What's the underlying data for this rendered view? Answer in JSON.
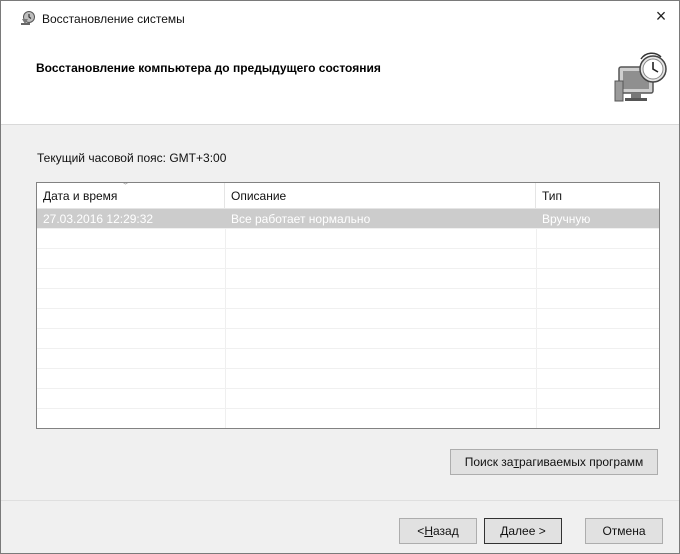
{
  "window": {
    "title": "Восстановление системы",
    "close_glyph": "×"
  },
  "header": {
    "heading": "Восстановление компьютера до предыдущего состояния",
    "icon": "system-restore-icon"
  },
  "timezone_label": "Текущий часовой пояс: GMT+3:00",
  "restore_points": {
    "columns": [
      "Дата и время",
      "Описание",
      "Тип"
    ],
    "sort_indicator": "﹀",
    "rows": [
      {
        "datetime": "27.03.2016 12:29:32",
        "description": "Все работает нормально",
        "type": "Вручную",
        "selected": true
      }
    ]
  },
  "buttons": {
    "scan_pre": "Поиск за",
    "scan_mnemonic": "т",
    "scan_post": "рагиваемых программ",
    "back_pre": "< ",
    "back_mnemonic": "Н",
    "back_post": "азад",
    "next_mnemonic": "Д",
    "next_post": "алее >",
    "cancel": "Отмена"
  },
  "colors": {
    "selection": "#cccccc",
    "header_bg": "#ffffff",
    "dialog_bg": "#f0f0f0"
  }
}
